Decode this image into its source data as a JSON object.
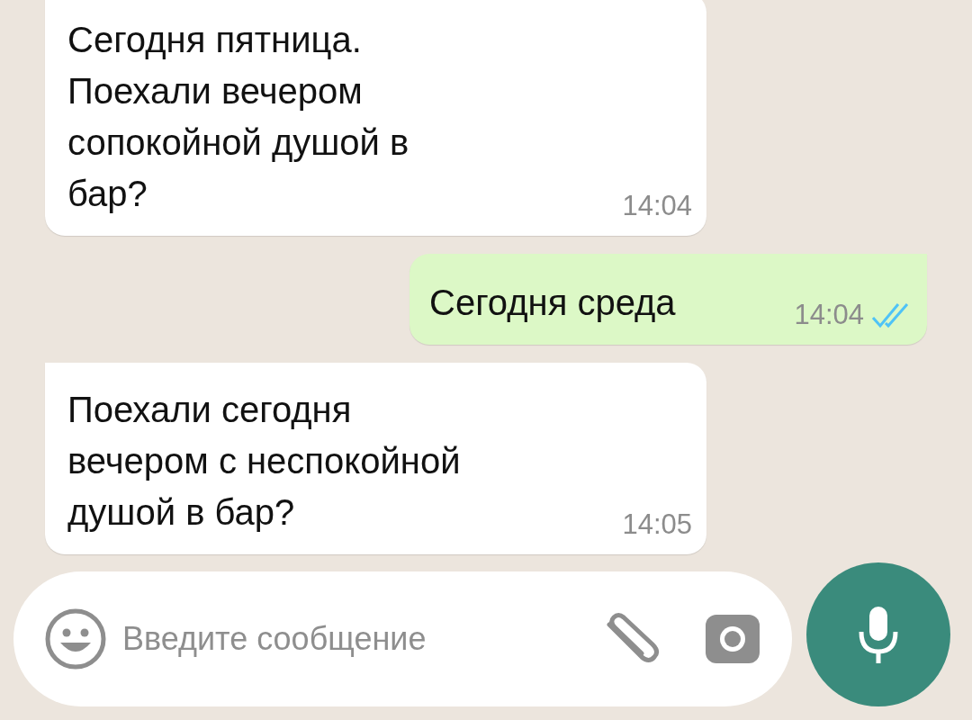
{
  "messages": [
    {
      "kind": "incoming",
      "lines": [
        "Сегодня пятница.",
        "Поехали вечером",
        "сопокойной душой в",
        "бар?"
      ],
      "time": "14:04"
    },
    {
      "kind": "outgoing",
      "lines": [
        "Сегодня среда"
      ],
      "time": "14:04",
      "read": true
    },
    {
      "kind": "incoming",
      "lines": [
        "Поехали сегодня",
        "вечером с неспокойной",
        "душой в бар?"
      ],
      "time": "14:05"
    }
  ],
  "composer": {
    "placeholder": "Введите сообщение"
  }
}
